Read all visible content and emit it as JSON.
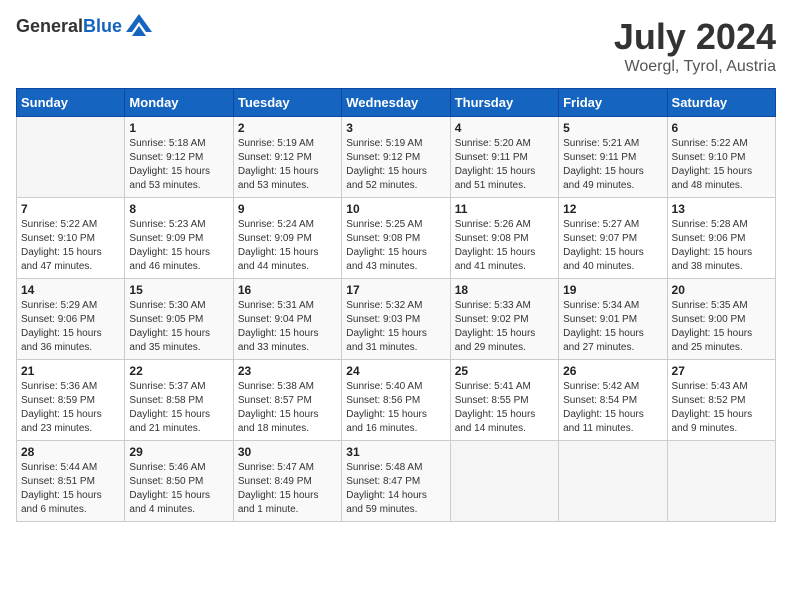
{
  "header": {
    "logo_general": "General",
    "logo_blue": "Blue",
    "month": "July 2024",
    "location": "Woergl, Tyrol, Austria"
  },
  "calendar": {
    "weekdays": [
      "Sunday",
      "Monday",
      "Tuesday",
      "Wednesday",
      "Thursday",
      "Friday",
      "Saturday"
    ],
    "weeks": [
      [
        {
          "day": "",
          "info": ""
        },
        {
          "day": "1",
          "info": "Sunrise: 5:18 AM\nSunset: 9:12 PM\nDaylight: 15 hours\nand 53 minutes."
        },
        {
          "day": "2",
          "info": "Sunrise: 5:19 AM\nSunset: 9:12 PM\nDaylight: 15 hours\nand 53 minutes."
        },
        {
          "day": "3",
          "info": "Sunrise: 5:19 AM\nSunset: 9:12 PM\nDaylight: 15 hours\nand 52 minutes."
        },
        {
          "day": "4",
          "info": "Sunrise: 5:20 AM\nSunset: 9:11 PM\nDaylight: 15 hours\nand 51 minutes."
        },
        {
          "day": "5",
          "info": "Sunrise: 5:21 AM\nSunset: 9:11 PM\nDaylight: 15 hours\nand 49 minutes."
        },
        {
          "day": "6",
          "info": "Sunrise: 5:22 AM\nSunset: 9:10 PM\nDaylight: 15 hours\nand 48 minutes."
        }
      ],
      [
        {
          "day": "7",
          "info": "Sunrise: 5:22 AM\nSunset: 9:10 PM\nDaylight: 15 hours\nand 47 minutes."
        },
        {
          "day": "8",
          "info": "Sunrise: 5:23 AM\nSunset: 9:09 PM\nDaylight: 15 hours\nand 46 minutes."
        },
        {
          "day": "9",
          "info": "Sunrise: 5:24 AM\nSunset: 9:09 PM\nDaylight: 15 hours\nand 44 minutes."
        },
        {
          "day": "10",
          "info": "Sunrise: 5:25 AM\nSunset: 9:08 PM\nDaylight: 15 hours\nand 43 minutes."
        },
        {
          "day": "11",
          "info": "Sunrise: 5:26 AM\nSunset: 9:08 PM\nDaylight: 15 hours\nand 41 minutes."
        },
        {
          "day": "12",
          "info": "Sunrise: 5:27 AM\nSunset: 9:07 PM\nDaylight: 15 hours\nand 40 minutes."
        },
        {
          "day": "13",
          "info": "Sunrise: 5:28 AM\nSunset: 9:06 PM\nDaylight: 15 hours\nand 38 minutes."
        }
      ],
      [
        {
          "day": "14",
          "info": "Sunrise: 5:29 AM\nSunset: 9:06 PM\nDaylight: 15 hours\nand 36 minutes."
        },
        {
          "day": "15",
          "info": "Sunrise: 5:30 AM\nSunset: 9:05 PM\nDaylight: 15 hours\nand 35 minutes."
        },
        {
          "day": "16",
          "info": "Sunrise: 5:31 AM\nSunset: 9:04 PM\nDaylight: 15 hours\nand 33 minutes."
        },
        {
          "day": "17",
          "info": "Sunrise: 5:32 AM\nSunset: 9:03 PM\nDaylight: 15 hours\nand 31 minutes."
        },
        {
          "day": "18",
          "info": "Sunrise: 5:33 AM\nSunset: 9:02 PM\nDaylight: 15 hours\nand 29 minutes."
        },
        {
          "day": "19",
          "info": "Sunrise: 5:34 AM\nSunset: 9:01 PM\nDaylight: 15 hours\nand 27 minutes."
        },
        {
          "day": "20",
          "info": "Sunrise: 5:35 AM\nSunset: 9:00 PM\nDaylight: 15 hours\nand 25 minutes."
        }
      ],
      [
        {
          "day": "21",
          "info": "Sunrise: 5:36 AM\nSunset: 8:59 PM\nDaylight: 15 hours\nand 23 minutes."
        },
        {
          "day": "22",
          "info": "Sunrise: 5:37 AM\nSunset: 8:58 PM\nDaylight: 15 hours\nand 21 minutes."
        },
        {
          "day": "23",
          "info": "Sunrise: 5:38 AM\nSunset: 8:57 PM\nDaylight: 15 hours\nand 18 minutes."
        },
        {
          "day": "24",
          "info": "Sunrise: 5:40 AM\nSunset: 8:56 PM\nDaylight: 15 hours\nand 16 minutes."
        },
        {
          "day": "25",
          "info": "Sunrise: 5:41 AM\nSunset: 8:55 PM\nDaylight: 15 hours\nand 14 minutes."
        },
        {
          "day": "26",
          "info": "Sunrise: 5:42 AM\nSunset: 8:54 PM\nDaylight: 15 hours\nand 11 minutes."
        },
        {
          "day": "27",
          "info": "Sunrise: 5:43 AM\nSunset: 8:52 PM\nDaylight: 15 hours\nand 9 minutes."
        }
      ],
      [
        {
          "day": "28",
          "info": "Sunrise: 5:44 AM\nSunset: 8:51 PM\nDaylight: 15 hours\nand 6 minutes."
        },
        {
          "day": "29",
          "info": "Sunrise: 5:46 AM\nSunset: 8:50 PM\nDaylight: 15 hours\nand 4 minutes."
        },
        {
          "day": "30",
          "info": "Sunrise: 5:47 AM\nSunset: 8:49 PM\nDaylight: 15 hours\nand 1 minute."
        },
        {
          "day": "31",
          "info": "Sunrise: 5:48 AM\nSunset: 8:47 PM\nDaylight: 14 hours\nand 59 minutes."
        },
        {
          "day": "",
          "info": ""
        },
        {
          "day": "",
          "info": ""
        },
        {
          "day": "",
          "info": ""
        }
      ]
    ]
  }
}
